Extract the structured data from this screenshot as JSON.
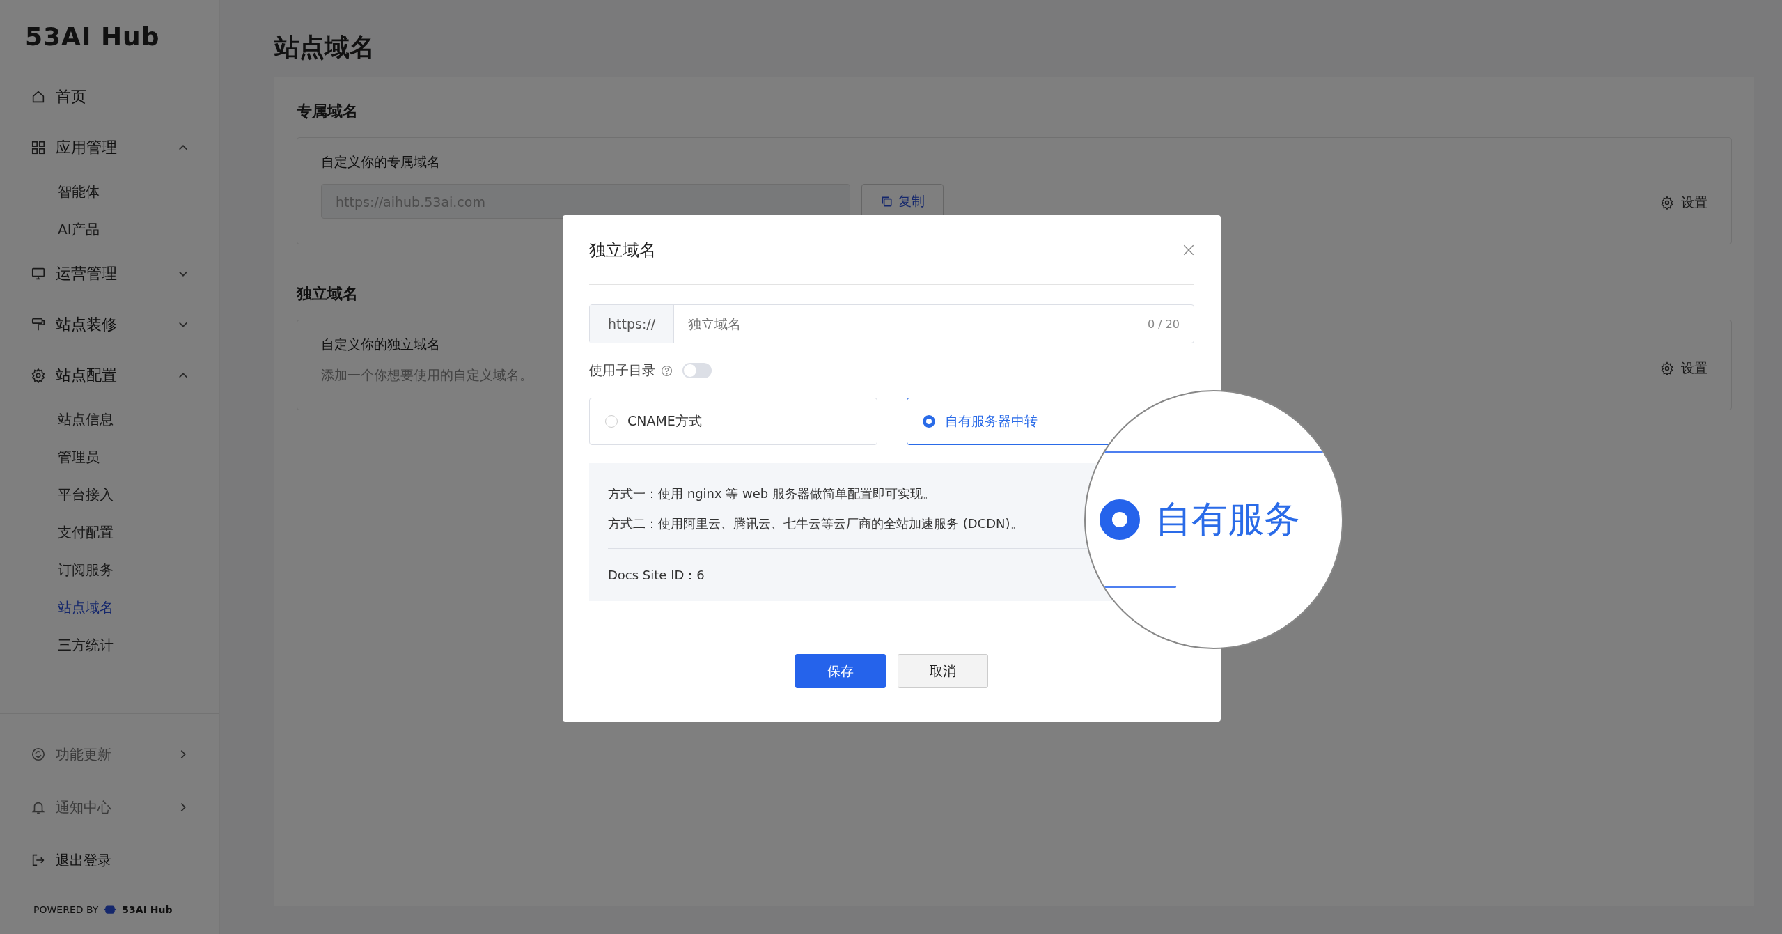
{
  "sidebar": {
    "logo": "53AI Hub",
    "items": [
      {
        "label": "首页"
      },
      {
        "label": "应用管理",
        "expanded": true,
        "children": [
          {
            "label": "智能体",
            "selected": false
          },
          {
            "label": "AI产品",
            "selected": false
          }
        ]
      },
      {
        "label": "运营管理",
        "expanded": false
      },
      {
        "label": "站点装修",
        "expanded": false
      },
      {
        "label": "站点配置",
        "expanded": true,
        "children": [
          {
            "label": "站点信息",
            "selected": false
          },
          {
            "label": "管理员",
            "selected": false
          },
          {
            "label": "平台接入",
            "selected": false
          },
          {
            "label": "支付配置",
            "selected": false
          },
          {
            "label": "订阅服务",
            "selected": false
          },
          {
            "label": "站点域名",
            "selected": true
          },
          {
            "label": "三方统计",
            "selected": false
          }
        ]
      }
    ],
    "footer": [
      {
        "label": "功能更新",
        "kind": "submenu"
      },
      {
        "label": "通知中心",
        "kind": "submenu"
      },
      {
        "label": "退出登录",
        "kind": "action"
      }
    ],
    "powered_by": {
      "label": "POWERED BY",
      "brand": "53AI Hub"
    }
  },
  "page": {
    "title": "站点域名",
    "sections": [
      {
        "heading": "专属域名",
        "label": "自定义你的专属域名",
        "kind": "field",
        "value": "https://aihub.53ai.com",
        "button": "复制",
        "settings": "设置"
      },
      {
        "heading": "独立域名",
        "label": "自定义你的独立域名",
        "kind": "hint",
        "hint": "添加一个你想要使用的自定义域名。",
        "settings": "设置"
      }
    ]
  },
  "dialog": {
    "title": "独立域名",
    "prefix": "https://",
    "placeholder": "独立域名",
    "counter": "0 / 20",
    "toggle": {
      "label": "使用子目录",
      "on": false
    },
    "options": [
      {
        "label": "CNAME方式",
        "selected": false
      },
      {
        "label": "自有服务器中转",
        "selected": true
      }
    ],
    "notes": [
      "方式一：使用 nginx 等 web 服务器做简单配置即可实现。",
      "方式二：使用阿里云、腾讯云、七牛云等云厂商的全站加速服务 (DCDN)。"
    ],
    "site_id": "Docs Site ID：6",
    "buttons": [
      {
        "label": "保存",
        "kind": "primary"
      },
      {
        "label": "取消",
        "kind": "default"
      }
    ],
    "magnifier": {
      "text": "自有服务",
      "selected": true
    }
  }
}
